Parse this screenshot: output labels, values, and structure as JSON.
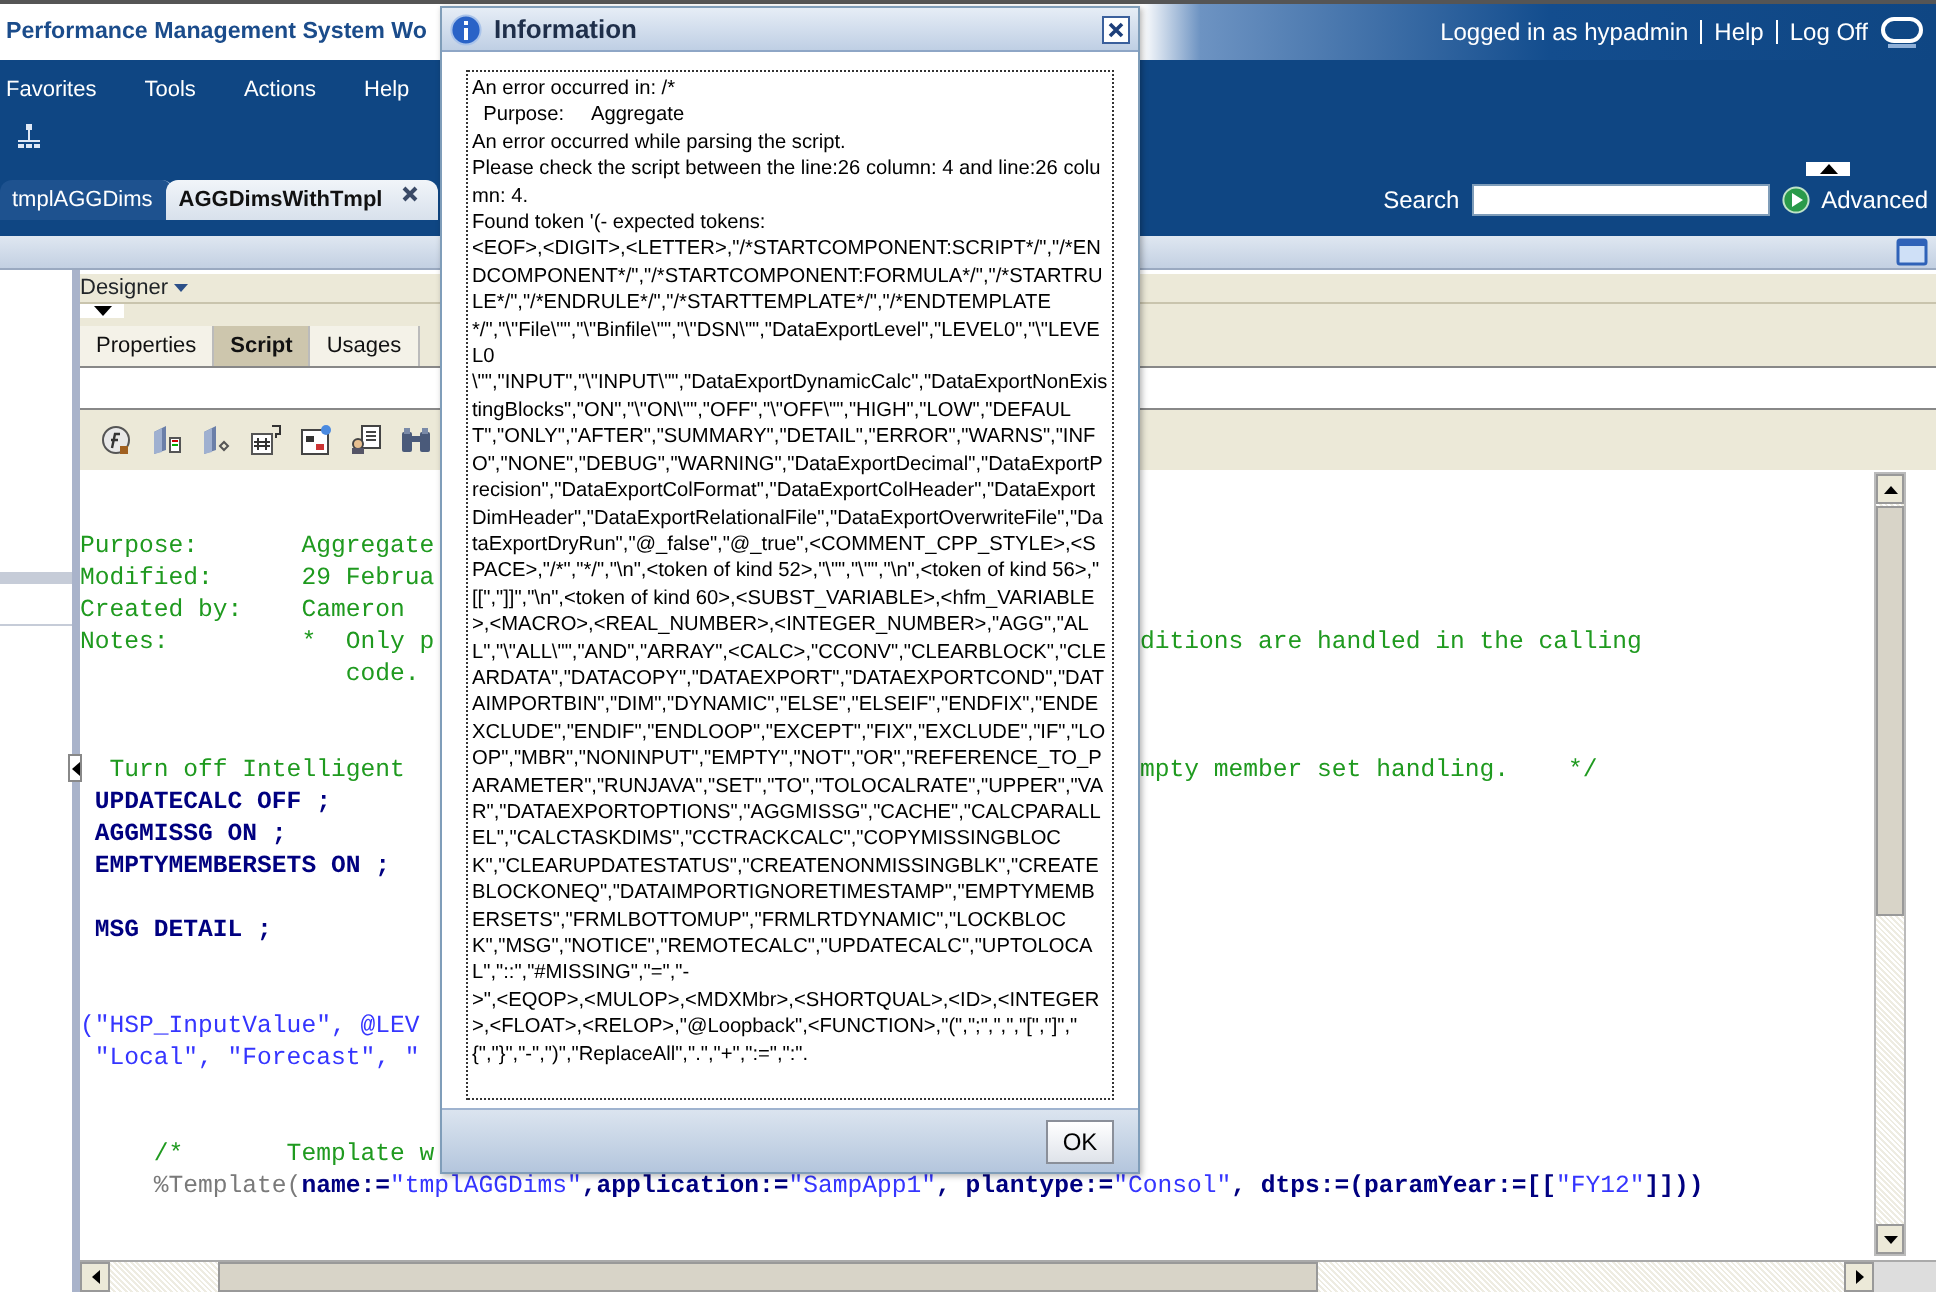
{
  "header": {
    "title": "Performance Management System Wo",
    "user": "Logged in as hypadmin",
    "links": [
      "Help",
      "Log Off"
    ]
  },
  "menu": [
    "Favorites",
    "Tools",
    "Actions",
    "Help"
  ],
  "doc_tabs": [
    {
      "label": "tmplAGGDims",
      "selected": false
    },
    {
      "label": "AGGDimsWithTmpl",
      "selected": true
    }
  ],
  "search": {
    "label": "Search",
    "advanced": "Advanced"
  },
  "designer": {
    "label": "Designer"
  },
  "panel_tabs": [
    {
      "label": "Properties",
      "selected": false
    },
    {
      "label": "Script",
      "selected": true
    },
    {
      "label": "Usages",
      "selected": false
    }
  ],
  "code_lines": [
    {
      "kind": "code",
      "left": [
        {
          "text": "Purpose:       Aggregate",
          "kind": "comment"
        }
      ]
    },
    {
      "kind": "code",
      "left": [
        {
          "text": "Modified:      29 Februa",
          "kind": "comment"
        }
      ]
    },
    {
      "kind": "code",
      "left": [
        {
          "text": "Created by:    Cameron",
          "kind": "comment"
        }
      ]
    },
    {
      "kind": "code",
      "left": [
        {
          "text": "Notes:         *  Only p",
          "kind": "comment"
        }
      ],
      "right": [
        {
          "text": "ditions are handled in the calling",
          "kind": "comment"
        }
      ]
    },
    {
      "kind": "code",
      "left": [
        {
          "text": "                  code.",
          "kind": "comment"
        }
      ]
    },
    {
      "kind": "blank"
    },
    {
      "kind": "blank"
    },
    {
      "kind": "code",
      "left": [
        {
          "text": "  Turn off Intelligent",
          "kind": "comment"
        }
      ],
      "right": [
        {
          "text": "mpty member set handling.    */",
          "kind": "comment"
        }
      ]
    },
    {
      "kind": "code",
      "left": [
        {
          "text": " UPDATECALC OFF ;",
          "kind": "keyword"
        }
      ]
    },
    {
      "kind": "code",
      "left": [
        {
          "text": " AGGMISSG ON ;",
          "kind": "keyword"
        }
      ]
    },
    {
      "kind": "code",
      "left": [
        {
          "text": " EMPTYMEMBERSETS ON ;",
          "kind": "keyword"
        }
      ]
    },
    {
      "kind": "blank"
    },
    {
      "kind": "code",
      "left": [
        {
          "text": " MSG DETAIL ;",
          "kind": "keyword"
        }
      ]
    },
    {
      "kind": "blank"
    },
    {
      "kind": "blank"
    },
    {
      "kind": "code",
      "left": [
        {
          "text": "(\"HSP_InputValue\", @LEV",
          "kind": "string"
        }
      ]
    },
    {
      "kind": "code",
      "left": [
        {
          "text": " \"Local\", \"Forecast\", \"",
          "kind": "string"
        }
      ]
    },
    {
      "kind": "blank"
    },
    {
      "kind": "blank"
    },
    {
      "kind": "code",
      "left": [
        {
          "text": "     /*       Template w",
          "kind": "comment"
        }
      ]
    },
    {
      "kind": "code",
      "left": [
        {
          "text": "     %Template(",
          "kind": "macro"
        },
        {
          "text": "name:=",
          "kind": "keyword"
        },
        {
          "text": "\"tmplAGGDims\"",
          "kind": "string"
        },
        {
          "text": ",application:=",
          "kind": "keyword"
        },
        {
          "text": "\"SampApp1\"",
          "kind": "string"
        },
        {
          "text": ", plantype:=",
          "kind": "keyword"
        },
        {
          "text": "\"Consol\"",
          "kind": "string"
        },
        {
          "text": ", dtps:=(paramYear:=[[",
          "kind": "keyword"
        },
        {
          "text": "\"FY12\"",
          "kind": "string"
        },
        {
          "text": "]]))",
          "kind": "keyword"
        }
      ]
    }
  ],
  "dialog": {
    "title": "Information",
    "button": "OK",
    "message": "An error occurred in: /*\n  Purpose:     Aggregate\nAn error occurred while parsing the script.\nPlease check the script between the line:26 column: 4 and line:26 column: 4.\nFound token '(- expected tokens:\n<EOF>,<DIGIT>,<LETTER>,\"/*STARTCOMPONENT:SCRIPT*/\",\"/*ENDCOMPONENT*/\",\"/*STARTCOMPONENT:FORMULA*/\",\"/*STARTRULE*/\",\"/*ENDRULE*/\",\"/*STARTTEMPLATE*/\",\"/*ENDTEMPLATE*/\",\"\\\"File\\\"\",\"\\\"Binfile\\\"\",\"\\\"DSN\\\"\",\"DataExportLevel\",\"LEVEL0\",\"\\\"LEVEL0\n\\\"\",\"INPUT\",\"\\\"INPUT\\\"\",\"DataExportDynamicCalc\",\"DataExportNonExistingBlocks\",\"ON\",\"\\\"ON\\\"\",\"OFF\",\"\\\"OFF\\\"\",\"HIGH\",\"LOW\",\"DEFAULT\",\"ONLY\",\"AFTER\",\"SUMMARY\",\"DETAIL\",\"ERROR\",\"WARNS\",\"INFO\",\"NONE\",\"DEBUG\",\"WARNING\",\"DataExportDecimal\",\"DataExportPrecision\",\"DataExportColFormat\",\"DataExportColHeader\",\"DataExportDimHeader\",\"DataExportRelationalFile\",\"DataExportOverwriteFile\",\"DataExportDryRun\",\"@_false\",\"@_true\",<COMMENT_CPP_STYLE>,<SPACE>,\"/*\",\"*/\",\"\\n\",<token of kind 52>,\"\\\"\",\"\\\"\",\"\\n\",<token of kind 56>,\"[[\",\"]]\",\"\\n\",<token of kind 60>,<SUBST_VARIABLE>,<hfm_VARIABLE>,<MACRO>,<REAL_NUMBER>,<INTEGER_NUMBER>,\"AGG\",\"ALL\",\"\\\"ALL\\\"\",\"AND\",\"ARRAY\",<CALC>,\"CCONV\",\"CLEARBLOCK\",\"CLEARDATA\",\"DATACOPY\",\"DATAEXPORT\",\"DATAEXPORTCOND\",\"DATAIMPORTBIN\",\"DIM\",\"DYNAMIC\",\"ELSE\",\"ELSEIF\",\"ENDFIX\",\"ENDEXCLUDE\",\"ENDIF\",\"ENDLOOP\",\"EXCEPT\",\"FIX\",\"EXCLUDE\",\"IF\",\"LOOP\",\"MBR\",\"NONINPUT\",\"EMPTY\",\"NOT\",\"OR\",\"REFERENCE_TO_PARAMETER\",\"RUNJAVA\",\"SET\",\"TO\",\"TOLOCALRATE\",\"UPPER\",\"VAR\",\"DATAEXPORTOPTIONS\",\"AGGMISSG\",\"CACHE\",\"CALCPARALLEL\",\"CALCTASKDIMS\",\"CCTRACKCALC\",\"COPYMISSINGBLOCK\",\"CLEARUPDATESTATUS\",\"CREATENONMISSINGBLK\",\"CREATEBLOCKONEQ\",\"DATAIMPORTIGNORETIMESTAMP\",\"EMPTYMEMBERSETS\",\"FRMLBOTTOMUP\",\"FRMLRTDYNAMIC\",\"LOCKBLOCK\",\"MSG\",\"NOTICE\",\"REMOTECALC\",\"UPDATECALC\",\"UPTOLOCAL\",\"::\",\"#MISSING\",\"=\",\"-\n>\",<EQOP>,<MULOP>,<MDXMbr>,<SHORTQUAL>,<ID>,<INTEGER>,<FLOAT>,<RELOP>,\"@Loopback\",<FUNCTION>,\"(\",\";\",\",\",\"[\",\"]\",\"{\",\"}\",\"-\",\")\",\"ReplaceAll\",\".\",\"+\",\":=\",\":\"."
  }
}
